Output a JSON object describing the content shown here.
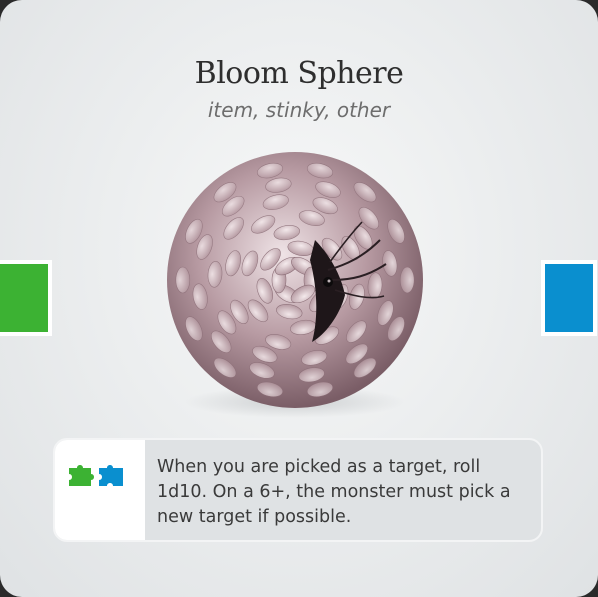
{
  "card": {
    "title": "Bloom Sphere",
    "subtitle": "item, stinky, other",
    "ability_text": "When you are picked as a target, roll 1d10. On a 6+, the monster must pick a new target if possible.",
    "ability_icons": [
      "puzzle-piece-icon-green",
      "puzzle-piece-icon-blue"
    ],
    "left_tab_color": "#3cb233",
    "right_tab_color": "#0a8fcf",
    "art_subject": "pink petal-covered sphere with dark creature emerging"
  }
}
